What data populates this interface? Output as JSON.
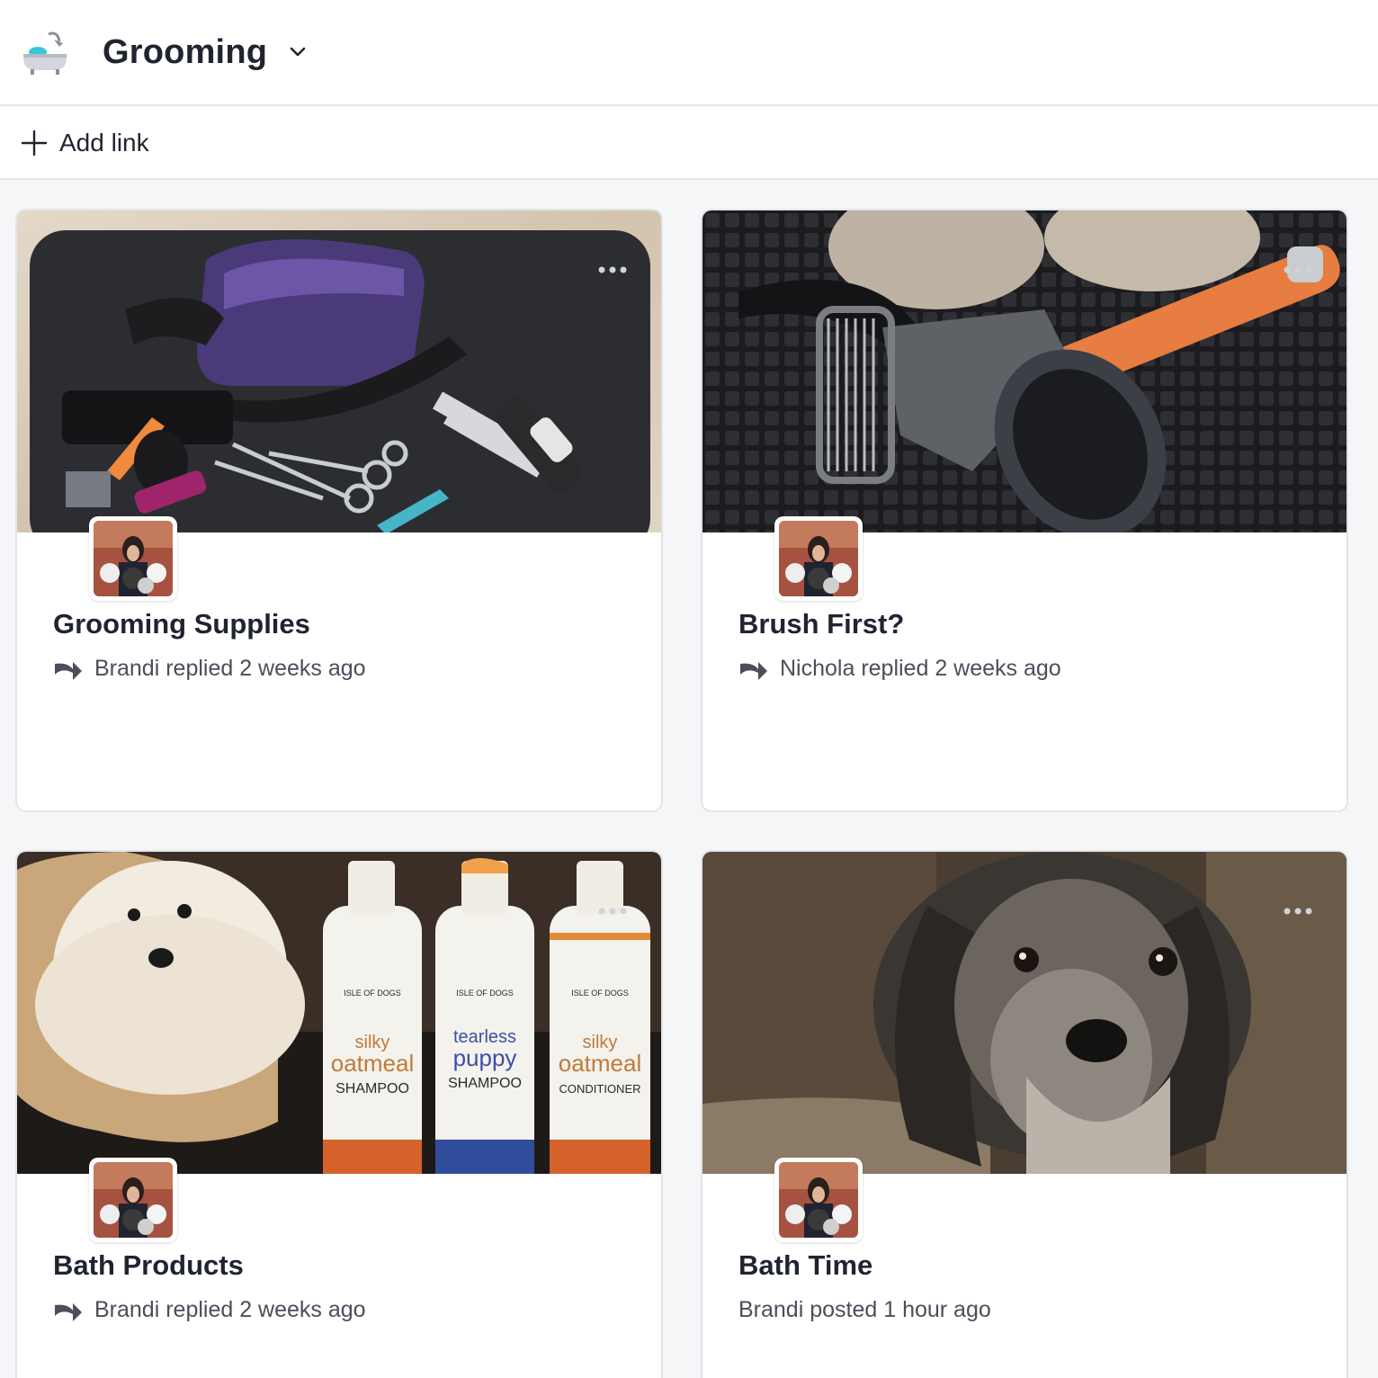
{
  "header": {
    "space_icon": "bathtub-icon",
    "title": "Grooming",
    "dropdown_icon": "chevron-down-icon"
  },
  "toolbar": {
    "add_link_icon": "plus-icon",
    "add_link_label": "Add link"
  },
  "cards": [
    {
      "title": "Grooming Supplies",
      "meta": "Brandi replied 2 weeks ago",
      "meta_icon": "reply-arrow-icon",
      "image": "grooming-tools-photo",
      "more_icon": "more-options-icon"
    },
    {
      "title": "Brush First?",
      "meta": "Nichola replied 2 weeks ago",
      "meta_icon": "reply-arrow-icon",
      "image": "brushes-photo",
      "more_icon": "more-options-icon"
    },
    {
      "title": "Bath Products",
      "meta": "Brandi replied 2 weeks ago",
      "meta_icon": "reply-arrow-icon",
      "image": "shampoo-bottles-photo",
      "more_icon": "more-options-icon",
      "bottles": [
        {
          "brand": "ISLE OF DOGS",
          "line1": "silky",
          "line2": "oatmeal",
          "line3": "SHAMPOO"
        },
        {
          "brand": "ISLE OF DOGS",
          "line1": "tearless",
          "line2": "puppy",
          "line3": "SHAMPOO"
        },
        {
          "brand": "ISLE OF DOGS",
          "line1": "silky",
          "line2": "oatmeal",
          "line3": "CONDITIONER"
        }
      ]
    },
    {
      "title": "Bath Time",
      "meta": "Brandi posted 1 hour ago",
      "image": "wet-dog-photo",
      "more_icon": "more-options-icon"
    }
  ],
  "colors": {
    "page_bg": "#f5f6f8",
    "text": "#1f2430",
    "meta_text": "#4a4f5a",
    "border": "#e3e5e9"
  }
}
